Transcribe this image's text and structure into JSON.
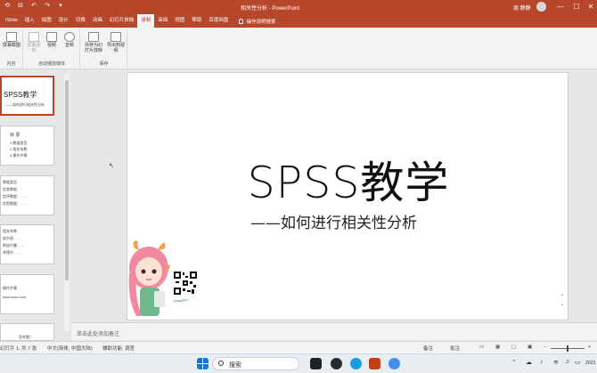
{
  "titlebar": {
    "quick_access": [
      "⟲",
      "⊟",
      "↶",
      "↷",
      "▾"
    ],
    "title": "相关性分析 - PowerPoint",
    "user": "周 静静",
    "window_buttons": [
      "—",
      "☐",
      "✕"
    ]
  },
  "tabs": {
    "items": [
      "ISlide",
      "插入",
      "绘图",
      "设计",
      "切换",
      "动画",
      "幻灯片放映",
      "录制",
      "审阅",
      "视图",
      "帮助",
      "百度网盘"
    ],
    "active": "录制",
    "search_label": "操作说明搜索"
  },
  "ribbon": {
    "group_content": {
      "button": "屏幕截图",
      "label": "内容"
    },
    "group_autoplay": {
      "buttons": [
        "屏幕录制",
        "视频",
        "音频"
      ],
      "label": "自动播放媒体"
    },
    "group_save": {
      "buttons": [
        "另存为幻灯片放映",
        "导出到视频"
      ],
      "label": "保存"
    }
  },
  "thumbnails": [
    {
      "lines": [
        "SPSS教学",
        "——如何进行相关性分析"
      ]
    },
    {
      "lines": [
        "目 录",
        "1.数据类型",
        "2.相关系数",
        "3.操作步骤"
      ]
    },
    {
      "lines": [
        "数据类型",
        "定类数据",
        "定序数据：……",
        "定距数据：……"
      ]
    },
    {
      "lines": [
        "相关系数",
        "皮尔逊……",
        "斯皮尔曼……",
        "肯德尔……"
      ]
    },
    {
      "lines": [
        "操作步骤",
        "www.xxxx.com"
      ]
    },
    {
      "lines": [
        "思考题？"
      ]
    }
  ],
  "slide": {
    "title": "SPSS教学",
    "subtitle": "——如何进行相关性分析",
    "qr_label": "youquPPT"
  },
  "notes": {
    "placeholder": "单击此处添加备注"
  },
  "statusbar": {
    "slide_index": "7",
    "slide_info": "幻灯片 1, 共 7 张",
    "language": "中文(简体, 中国大陆)",
    "accessibility": "辅助功能: 调查",
    "notes_label": "备注",
    "comments_label": "批注"
  },
  "taskbar": {
    "search_placeholder": "搜索",
    "time": "2023"
  }
}
